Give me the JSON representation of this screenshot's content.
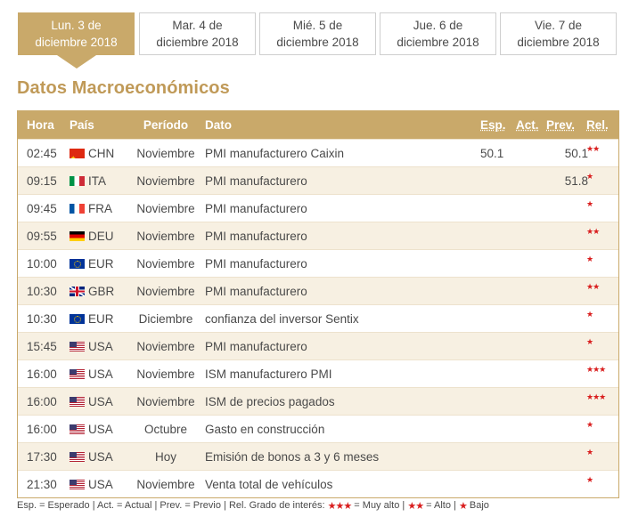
{
  "tabs": [
    {
      "line1": "Lun. 3 de",
      "line2": "diciembre 2018",
      "active": true
    },
    {
      "line1": "Mar. 4 de",
      "line2": "diciembre 2018",
      "active": false
    },
    {
      "line1": "Mié. 5 de",
      "line2": "diciembre 2018",
      "active": false
    },
    {
      "line1": "Jue. 6 de",
      "line2": "diciembre 2018",
      "active": false
    },
    {
      "line1": "Vie. 7 de",
      "line2": "diciembre 2018",
      "active": false
    }
  ],
  "section_title": "Datos Macroeconómicos",
  "columns": {
    "time": "Hora",
    "country": "País",
    "period": "Período",
    "event": "Dato",
    "expected": "Esp.",
    "actual": "Act.",
    "previous": "Prev.",
    "relevance": "Rel."
  },
  "rows": [
    {
      "time": "02:45",
      "flag": "chn",
      "country": "CHN",
      "period": "Noviembre",
      "event": "PMI manufacturero Caixin",
      "expected": "50.1",
      "actual": "",
      "previous": "50.1",
      "relevance": "★★"
    },
    {
      "time": "09:15",
      "flag": "ita",
      "country": "ITA",
      "period": "Noviembre",
      "event": "PMI manufacturero",
      "expected": "",
      "actual": "",
      "previous": "51.8",
      "relevance": "★"
    },
    {
      "time": "09:45",
      "flag": "fra",
      "country": "FRA",
      "period": "Noviembre",
      "event": "PMI manufacturero",
      "expected": "",
      "actual": "",
      "previous": "",
      "relevance": "★"
    },
    {
      "time": "09:55",
      "flag": "deu",
      "country": "DEU",
      "period": "Noviembre",
      "event": "PMI manufacturero",
      "expected": "",
      "actual": "",
      "previous": "",
      "relevance": "★★"
    },
    {
      "time": "10:00",
      "flag": "eur",
      "country": "EUR",
      "period": "Noviembre",
      "event": "PMI manufacturero",
      "expected": "",
      "actual": "",
      "previous": "",
      "relevance": "★"
    },
    {
      "time": "10:30",
      "flag": "gbr",
      "country": "GBR",
      "period": "Noviembre",
      "event": "PMI manufacturero",
      "expected": "",
      "actual": "",
      "previous": "",
      "relevance": "★★"
    },
    {
      "time": "10:30",
      "flag": "eur",
      "country": "EUR",
      "period": "Diciembre",
      "event": "confianza del inversor Sentix",
      "expected": "",
      "actual": "",
      "previous": "",
      "relevance": "★"
    },
    {
      "time": "15:45",
      "flag": "usa",
      "country": "USA",
      "period": "Noviembre",
      "event": "PMI manufacturero",
      "expected": "",
      "actual": "",
      "previous": "",
      "relevance": "★"
    },
    {
      "time": "16:00",
      "flag": "usa",
      "country": "USA",
      "period": "Noviembre",
      "event": "ISM manufacturero PMI",
      "expected": "",
      "actual": "",
      "previous": "",
      "relevance": "★★★"
    },
    {
      "time": "16:00",
      "flag": "usa",
      "country": "USA",
      "period": "Noviembre",
      "event": "ISM de precios pagados",
      "expected": "",
      "actual": "",
      "previous": "",
      "relevance": "★★★"
    },
    {
      "time": "16:00",
      "flag": "usa",
      "country": "USA",
      "period": "Octubre",
      "event": "Gasto en construcción",
      "expected": "",
      "actual": "",
      "previous": "",
      "relevance": "★"
    },
    {
      "time": "17:30",
      "flag": "usa",
      "country": "USA",
      "period": "Hoy",
      "event": "Emisión de bonos a 3 y 6 meses",
      "expected": "",
      "actual": "",
      "previous": "",
      "relevance": "★"
    },
    {
      "time": "21:30",
      "flag": "usa",
      "country": "USA",
      "period": "Noviembre",
      "event": "Venta total de vehículos",
      "expected": "",
      "actual": "",
      "previous": "",
      "relevance": "★"
    }
  ],
  "footer": {
    "part1": "Esp. = Esperado | Act. = Actual | Prev. = Previo | Rel. Grado de interés:",
    "stars3": "★★★",
    "part2": "= Muy alto |",
    "stars2": "★★",
    "part3": "= Alto |",
    "stars1": "★",
    "part4": "Bajo"
  },
  "colors": {
    "accent": "#c9a96a",
    "title": "#c09a58",
    "star": "#d91e1e",
    "row_alt": "#f7f0e2"
  }
}
